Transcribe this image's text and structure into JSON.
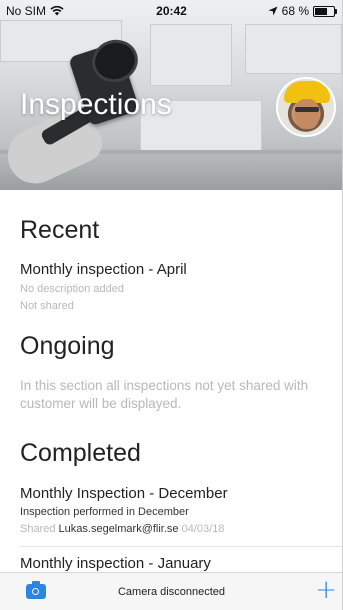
{
  "status_bar": {
    "carrier": "No SIM",
    "time": "20:42",
    "battery_percent": "68 %",
    "battery_level": 0.68
  },
  "header": {
    "title": "Inspections"
  },
  "sections": {
    "recent": {
      "heading": "Recent",
      "item": {
        "title": "Monthly inspection - April",
        "description": "No description added",
        "share_status": "Not shared"
      }
    },
    "ongoing": {
      "heading": "Ongoing",
      "placeholder": "In this section all inspections not yet shared with customer will be displayed."
    },
    "completed": {
      "heading": "Completed",
      "items": [
        {
          "title": "Monthly Inspection - December",
          "description": "Inspection performed in December",
          "shared_label": "Shared",
          "shared_with": "Lukas.segelmark@flir.se",
          "date": "04/03/18"
        },
        {
          "title": "Monthly inspection - January"
        }
      ]
    }
  },
  "toolbar": {
    "camera_status": "Camera disconnected",
    "accent_color": "#2a86e0"
  },
  "icons": {
    "wifi": "wifi-icon",
    "location": "location-arrow-icon",
    "battery": "battery-icon",
    "camera": "camera-icon",
    "add": "plus-icon"
  }
}
